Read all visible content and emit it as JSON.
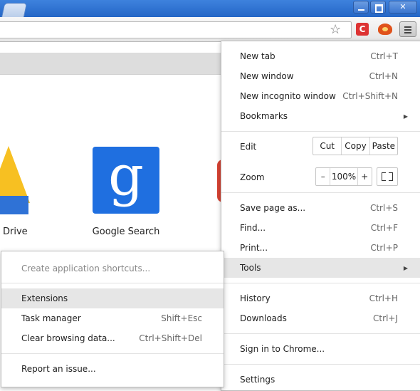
{
  "main_menu": {
    "new_tab": {
      "label": "New tab",
      "shortcut": "Ctrl+T"
    },
    "new_window": {
      "label": "New window",
      "shortcut": "Ctrl+N"
    },
    "new_incognito": {
      "label": "New incognito window",
      "shortcut": "Ctrl+Shift+N"
    },
    "bookmarks": {
      "label": "Bookmarks"
    },
    "edit": {
      "label": "Edit",
      "cut": "Cut",
      "copy": "Copy",
      "paste": "Paste"
    },
    "zoom": {
      "label": "Zoom",
      "minus": "–",
      "value": "100%",
      "plus": "+"
    },
    "save_page": {
      "label": "Save page as...",
      "shortcut": "Ctrl+S"
    },
    "find": {
      "label": "Find...",
      "shortcut": "Ctrl+F"
    },
    "print": {
      "label": "Print...",
      "shortcut": "Ctrl+P"
    },
    "tools": {
      "label": "Tools"
    },
    "history": {
      "label": "History",
      "shortcut": "Ctrl+H"
    },
    "downloads": {
      "label": "Downloads",
      "shortcut": "Ctrl+J"
    },
    "sign_in": {
      "label": "Sign in to Chrome..."
    },
    "settings": {
      "label": "Settings"
    }
  },
  "tools_submenu": {
    "create_shortcuts": {
      "label": "Create application shortcuts..."
    },
    "extensions": {
      "label": "Extensions"
    },
    "task_manager": {
      "label": "Task manager",
      "shortcut": "Shift+Esc"
    },
    "clear_browsing": {
      "label": "Clear browsing data...",
      "shortcut": "Ctrl+Shift+Del"
    },
    "report_issue": {
      "label": "Report an issue..."
    }
  },
  "apps": {
    "drive": {
      "label": "Drive"
    },
    "google_search": {
      "label": "Google Search",
      "glyph": "g"
    }
  },
  "toolbar": {
    "extension_c_glyph": "C",
    "star_glyph": "☆"
  },
  "colors": {
    "titlebar": "#2f6fd0",
    "highlight": "#e6e6e6",
    "google_blue": "#1f6fe0",
    "drive_yellow": "#f7c022"
  }
}
